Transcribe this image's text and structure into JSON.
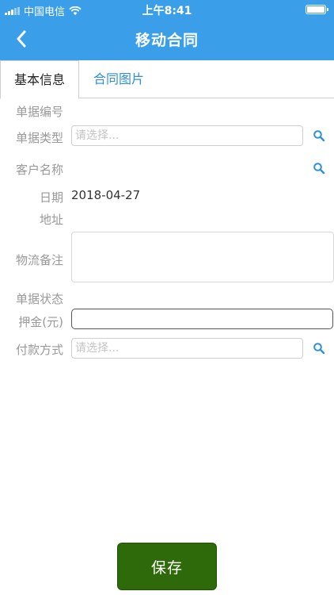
{
  "status_bar": {
    "carrier": "中国电信",
    "time": "上午8:41"
  },
  "nav": {
    "title": "移动合同"
  },
  "tabs": [
    {
      "label": "基本信息",
      "active": true
    },
    {
      "label": "合同图片",
      "active": false
    }
  ],
  "form": {
    "doc_number_label": "单据编号",
    "doc_type_label": "单据类型",
    "doc_type_placeholder": "请选择...",
    "customer_label": "客户名称",
    "date_label": "日期",
    "date_value": "2018-04-27",
    "address_label": "地址",
    "logistics_label": "物流备注",
    "doc_status_label": "单据状态",
    "deposit_label": "押金(元)",
    "payment_label": "付款方式",
    "payment_placeholder": "请选择..."
  },
  "actions": {
    "save_label": "保存"
  },
  "colors": {
    "header": "#3a9fe8",
    "tab_link": "#2f8fd8",
    "save_button": "#2f6a0a"
  },
  "icons": [
    "signal-icon",
    "wifi-icon",
    "battery-icon",
    "back-chevron-icon",
    "search-icon"
  ]
}
